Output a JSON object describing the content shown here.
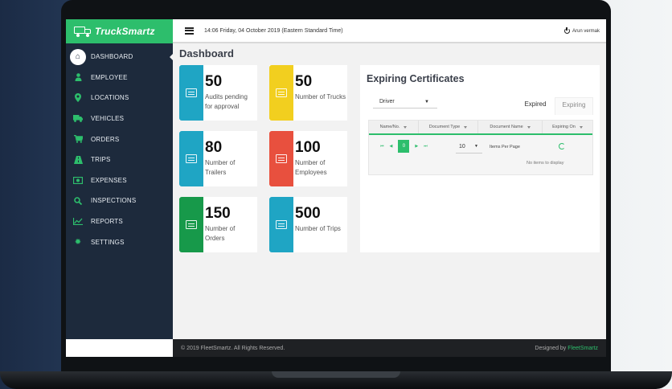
{
  "brand": {
    "name": "TruckSmartz"
  },
  "header": {
    "datetime": "14:06 Friday, 04 October 2019 (Eastern Standard Time)",
    "user": "Arun vermak"
  },
  "sidebar": {
    "items": [
      {
        "label": "DASHBOARD",
        "icon": "home-icon",
        "active": true
      },
      {
        "label": "EMPLOYEE",
        "icon": "person-icon"
      },
      {
        "label": "LOCATIONS",
        "icon": "map-pin-icon"
      },
      {
        "label": "VEHICLES",
        "icon": "truck-icon"
      },
      {
        "label": "ORDERS",
        "icon": "cart-icon"
      },
      {
        "label": "TRIPS",
        "icon": "road-icon"
      },
      {
        "label": "EXPENSES",
        "icon": "money-icon"
      },
      {
        "label": "INSPECTIONS",
        "icon": "search-icon"
      },
      {
        "label": "REPORTS",
        "icon": "chart-icon"
      },
      {
        "label": "SETTINGS",
        "icon": "gear-icon"
      }
    ]
  },
  "main": {
    "title": "Dashboard",
    "cards": [
      {
        "value": "50",
        "label": "Audits pending for approval",
        "color": "#1fa5c4"
      },
      {
        "value": "50",
        "label": "Number of Trucks",
        "color": "#f2cf1f"
      },
      {
        "value": "80",
        "label": "Number of Trailers",
        "color": "#1fa5c4"
      },
      {
        "value": "100",
        "label": "Number of Employees",
        "color": "#e8503e"
      },
      {
        "value": "150",
        "label": "Number of Orders",
        "color": "#17994a"
      },
      {
        "value": "500",
        "label": "Number of Trips",
        "color": "#1fa5c4"
      }
    ]
  },
  "certificates": {
    "title": "Expiring Certificates",
    "filter_value": "Driver",
    "tabs": {
      "expired": "Expired",
      "expiring": "Expiring"
    },
    "columns": [
      "Name/No.",
      "Document Type",
      "Document Name",
      "Expiring On"
    ],
    "pager": {
      "current_page": "0",
      "per_page": "10",
      "per_page_label": "Items Per Page"
    },
    "empty_message": "No items to display"
  },
  "footer": {
    "copyright": "© 2019 FleetSmartz. All Rights Reserved.",
    "designed_by": "Designed by",
    "designer": "FleetSmartz"
  }
}
